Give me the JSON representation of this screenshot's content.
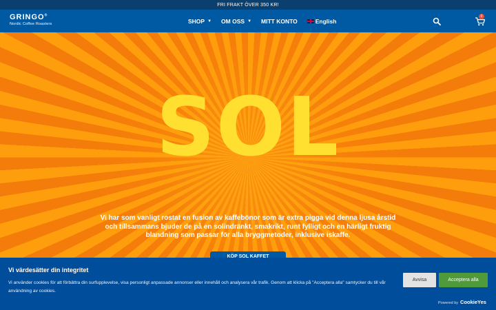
{
  "topbar": {
    "text": "FRI FRAKT ÖVER 350 KR!"
  },
  "header": {
    "logo_name": "GRINGO",
    "logo_sub": "Nordic Coffee Roasters",
    "menu": [
      {
        "label": "SHOP",
        "dropdown": true
      },
      {
        "label": "OM OSS",
        "dropdown": true
      },
      {
        "label": "MITT KONTO",
        "dropdown": false
      }
    ],
    "language": "English",
    "cart_count": "0",
    "icons": {
      "search": "search-icon",
      "cart": "cart-icon"
    }
  },
  "hero": {
    "title": "SOL",
    "text": "Vi har som vanligt rostat en fusion av kaffebönor som är extra pigga vid denna ljusa årstid och tillsammans bjuder de på en solindränkt, smakrikt, runt fylligt och en härligt fruktig blandning som passar för alla bryggmetoder, inklusive iskaffe.",
    "cta": "KÖP SOL KAFFET"
  },
  "cookie_banner": {
    "title": "Vi värdesätter din integritet",
    "text": "Vi använder cookies för att förbättra din surfupplevelse, visa personligt anpassade annonser eller innehåll och analysera vår trafik. Genom att klicka på \"Acceptera alla\" samtycker du till vår användning av cookies.",
    "reject_label": "Avvisa",
    "accept_label": "Acceptera alla",
    "powered_prefix": "Powered by",
    "powered_brand": "CookieYes"
  },
  "colors": {
    "topbar": "#0b3f6e",
    "nav": "#005aa3",
    "sun_text": "#ffe030",
    "accept": "#4f9a3a"
  }
}
